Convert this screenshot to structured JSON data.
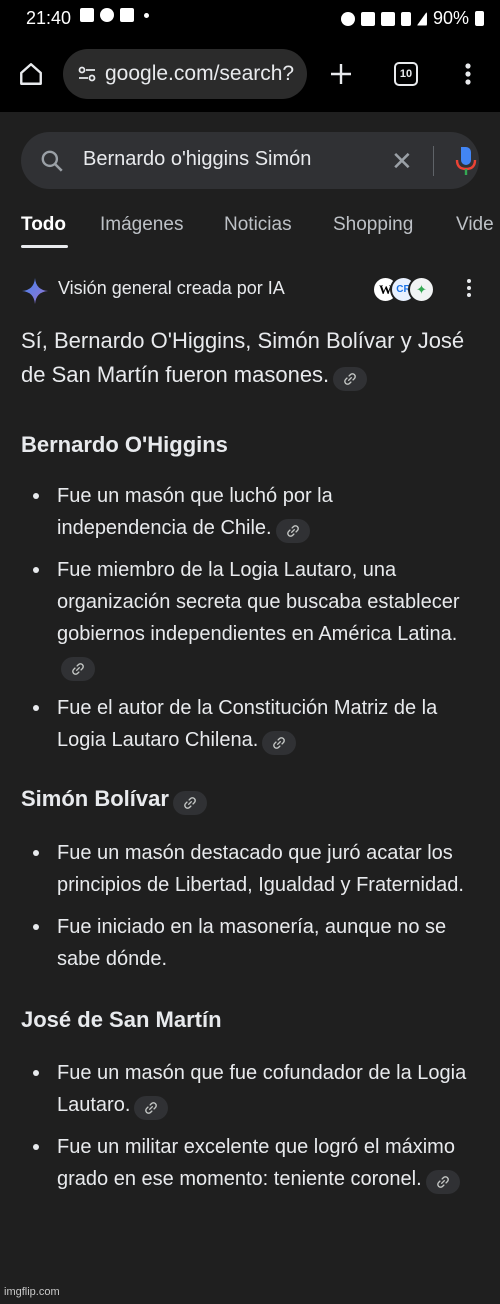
{
  "status_bar": {
    "time": "21:40",
    "battery": "90%"
  },
  "browser": {
    "url": "google.com/search?",
    "tab_count": "10",
    "home_icon": "home-icon",
    "new_tab_icon": "plus-icon",
    "menu_icon": "more-vert-icon"
  },
  "search": {
    "query": "Bernardo o'higgins Simón",
    "search_icon": "search-icon",
    "clear_icon": "close-icon",
    "mic_icon": "mic-icon"
  },
  "tabs": [
    {
      "label": "Todo",
      "active": true
    },
    {
      "label": "Imágenes"
    },
    {
      "label": "Noticias"
    },
    {
      "label": "Shopping"
    },
    {
      "label": "Vide"
    }
  ],
  "ai_overview": {
    "title": "Visión general creada por IA",
    "sources": [
      "W",
      "CR",
      "✦"
    ],
    "lead": "Sí, Bernardo O'Higgins, Simón Bolívar y José de San Martín fueron masones.",
    "sections": [
      {
        "heading": "Bernardo O'Higgins",
        "bullets": [
          "Fue un masón que luchó por la independencia de Chile.",
          "Fue miembro de la Logia Lautaro, una organización secreta que buscaba establecer gobiernos independientes en América Latina.",
          "Fue el autor de la Constitución Matriz de la Logia Lautaro Chilena."
        ]
      },
      {
        "heading": "Simón Bolívar",
        "bullets": [
          "Fue un masón destacado que juró acatar los principios de Libertad, Igualdad y Fraternidad.",
          "Fue iniciado en la masonería, aunque no se sabe dónde."
        ]
      },
      {
        "heading": "José de San Martín",
        "bullets": [
          "Fue un masón que fue cofundador de la Logia Lautaro.",
          "Fue un militar excelente que logró el máximo grado en ese momento: teniente coronel."
        ]
      }
    ]
  },
  "watermark": "imgflip.com",
  "colors": {
    "background": "#1f1f1f",
    "chip": "#303134",
    "text": "#e8eaed",
    "accent_blue": "#4285f4"
  }
}
